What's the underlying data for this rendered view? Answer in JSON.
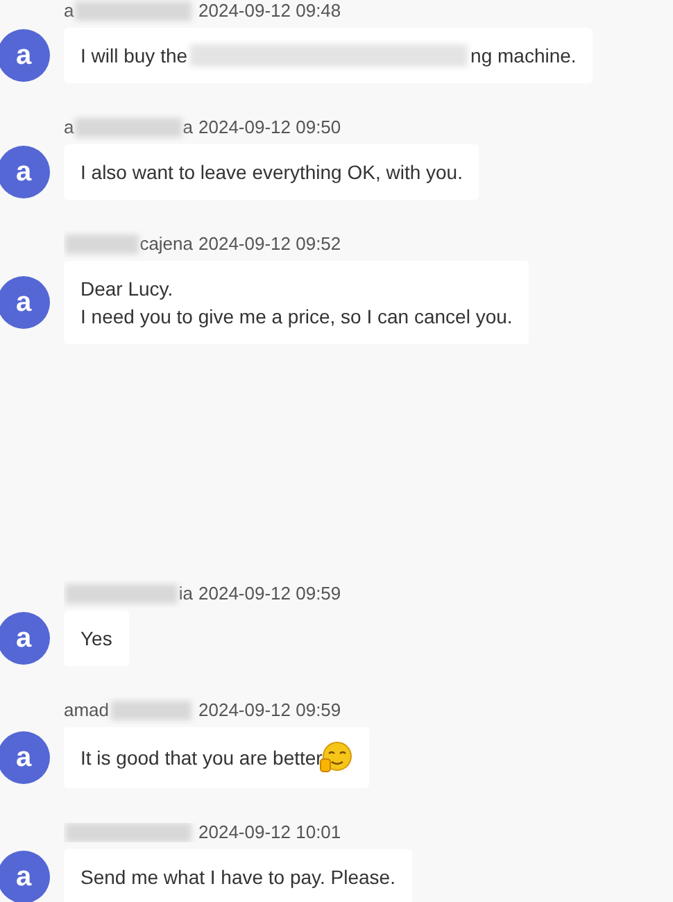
{
  "messages": [
    {
      "avatar_letter": "a",
      "name_start": "a",
      "time": "2024-09-12 09:48",
      "lines": [
        [
          {
            "kind": "text",
            "text": "I will buy the"
          },
          {
            "kind": "redacted"
          },
          {
            "kind": "text",
            "text": "ng machine."
          }
        ]
      ]
    },
    {
      "avatar_letter": "a",
      "name_start": "a",
      "name_end": "a",
      "time": "2024-09-12 09:50",
      "lines": [
        [
          {
            "kind": "text",
            "text": "I also want to leave everything OK, with you."
          }
        ]
      ]
    },
    {
      "avatar_letter": "a",
      "name_end": "cajena",
      "time": "2024-09-12 09:52",
      "lines": [
        [
          {
            "kind": "text",
            "text": "Dear Lucy."
          }
        ],
        [
          {
            "kind": "text",
            "text": "I need you to give me a price, so I can cancel you."
          }
        ]
      ]
    },
    {
      "avatar_letter": "a",
      "name_end": "ia",
      "time": "2024-09-12 09:59",
      "lines": [
        [
          {
            "kind": "text",
            "text": "Yes"
          }
        ]
      ]
    },
    {
      "avatar_letter": "a",
      "name_start": "amad",
      "time": "2024-09-12 09:59",
      "lines": [
        [
          {
            "kind": "text",
            "text": "It is good that you are better"
          },
          {
            "kind": "emoji"
          }
        ]
      ]
    },
    {
      "avatar_letter": "a",
      "time": "2024-09-12 10:01",
      "lines": [
        [
          {
            "kind": "text",
            "text": "Send me what I have to pay. Please."
          }
        ]
      ]
    }
  ]
}
